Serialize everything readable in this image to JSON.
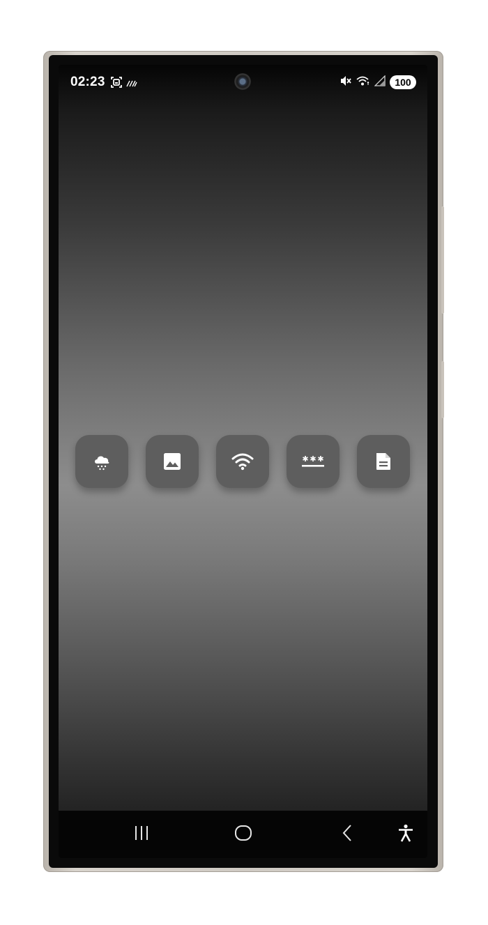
{
  "status_bar": {
    "time": "02:23",
    "battery": "100",
    "left_icons": [
      "screenshot-icon",
      "nfc-icon"
    ],
    "right_icons": [
      "mute-icon",
      "wifi-icon",
      "signal-icon"
    ]
  },
  "apps": [
    {
      "name": "weather",
      "icon": "cloud-snow-icon"
    },
    {
      "name": "gallery",
      "icon": "image-icon"
    },
    {
      "name": "wifi",
      "icon": "wifi-icon"
    },
    {
      "name": "password",
      "icon": "password-icon"
    },
    {
      "name": "document",
      "icon": "document-icon"
    }
  ],
  "navigation": {
    "items": [
      "recents-icon",
      "home-icon",
      "back-icon",
      "accessibility-icon"
    ]
  },
  "colors": {
    "app_button": "#5e5e5e",
    "icon": "#ffffff",
    "nav_bar": "#050505",
    "frame": "#d1ccc5"
  }
}
